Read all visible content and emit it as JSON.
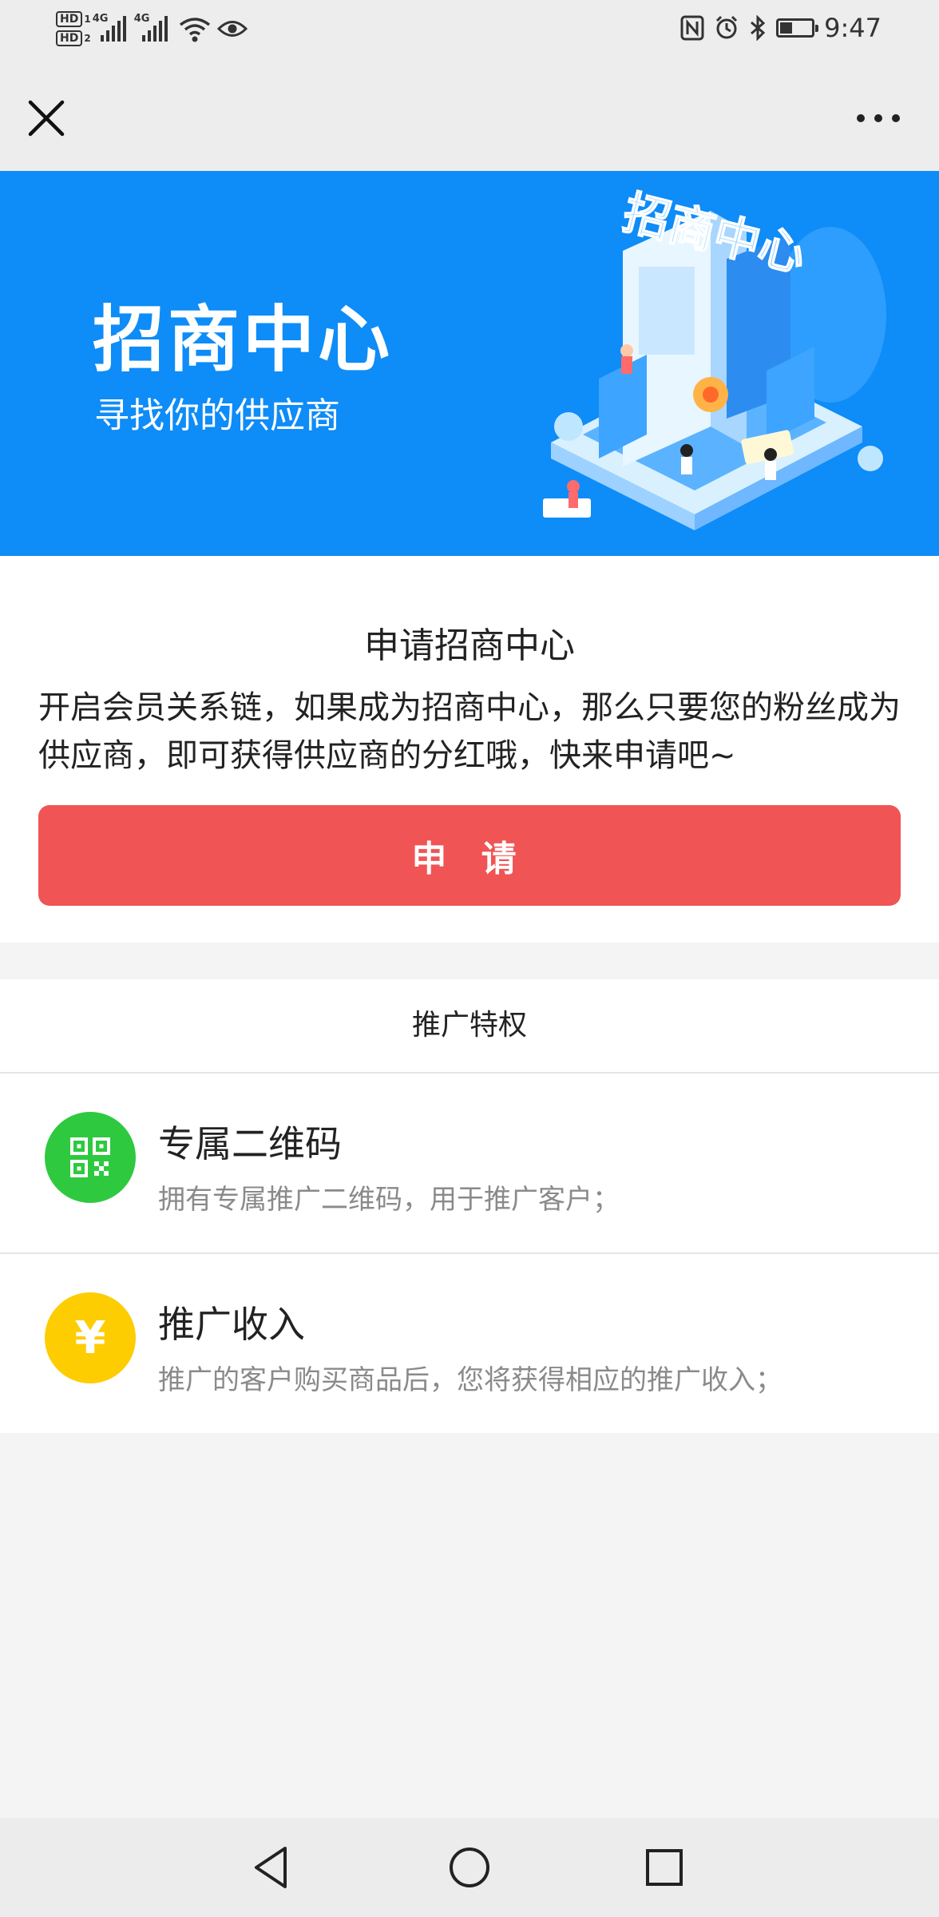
{
  "status_bar": {
    "hd1": "HD",
    "hd1_sub": "1",
    "hd2": "HD",
    "hd2_sub": "2",
    "signal1_label": "4G",
    "signal2_label": "4G",
    "time": "9:47",
    "battery_level": 0.4,
    "icons": [
      "nfc-icon",
      "alarm-icon",
      "bluetooth-icon",
      "battery-icon",
      "wifi-icon",
      "eye-icon"
    ]
  },
  "nav": {
    "close_icon": "close-icon",
    "more_icon": "more-icon"
  },
  "banner": {
    "title": "招商中心",
    "subtitle": "寻找你的供应商",
    "art_title": "招商中心",
    "background": "#0e8cf7"
  },
  "apply": {
    "title": "申请招商中心",
    "description": "开启会员关系链，如果成为招商中心，那么只要您的粉丝成为供应商，即可获得供应商的分红哦，快来申请吧~",
    "button_label": "申 请",
    "button_color": "#f05455"
  },
  "privileges": {
    "header": "推广特权",
    "items": [
      {
        "icon": "qr-code-icon",
        "icon_color": "#2ec93f",
        "title": "专属二维码",
        "desc": "拥有专属推广二维码，用于推广客户；"
      },
      {
        "icon": "yen-icon",
        "icon_symbol": "¥",
        "icon_color": "#fdcd02",
        "title": "推广收入",
        "desc": "推广的客户购买商品后，您将获得相应的推广收入；"
      }
    ]
  },
  "system_nav": {
    "icons": [
      "back-icon",
      "home-icon",
      "recents-icon"
    ]
  }
}
